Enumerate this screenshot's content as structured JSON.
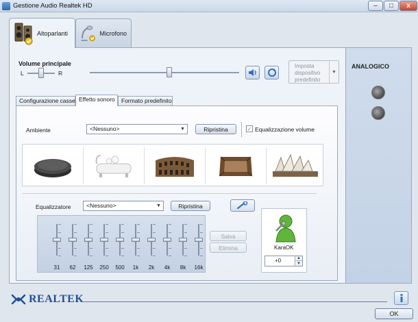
{
  "window": {
    "title": "Gestione Audio Realtek HD",
    "minimize": "–",
    "maximize": "□",
    "close": "x"
  },
  "device_tabs": [
    {
      "label": "Altoparlanti",
      "icon": "speakers-icon",
      "active": true
    },
    {
      "label": "Microfono",
      "icon": "microphone-icon",
      "active": false
    }
  ],
  "volume": {
    "title": "Volume principale",
    "left_label": "L",
    "right_label": "R",
    "balance_fraction": 0.5,
    "level_fraction": 0.52
  },
  "default_device": {
    "label": "Imposta dispositivo predefinito",
    "arrow": "▼"
  },
  "side_panel": {
    "label": "ANALOGICO",
    "jack_color": "#6e6e6e"
  },
  "sub_tabs": [
    {
      "label": "Configurazione casse",
      "active": false
    },
    {
      "label": "Effetto sonoro",
      "active": true
    },
    {
      "label": "Formato predefinito",
      "active": false
    }
  ],
  "environment": {
    "label": "Ambiente",
    "value": "<Nessuno>",
    "reset_label": "Ripristina",
    "loudness_label": "Equalizzazione volume",
    "loudness_checked": true,
    "presets": [
      "stone-icon",
      "bathtub-icon",
      "colosseum-icon",
      "arena-icon",
      "opera-house-icon"
    ]
  },
  "equalizer": {
    "label": "Equalizzatore",
    "value": "<Nessuno>",
    "reset_label": "Ripristina",
    "save_label": "Salva",
    "delete_label": "Elimina",
    "bands": [
      "31",
      "62",
      "125",
      "250",
      "500",
      "1k",
      "2k",
      "4k",
      "8k",
      "16k"
    ],
    "band_levels": [
      0.5,
      0.5,
      0.5,
      0.5,
      0.5,
      0.5,
      0.5,
      0.5,
      0.5,
      0.5
    ]
  },
  "karaoke": {
    "label": "KaraOK",
    "value": "+0",
    "up": "▲",
    "down": "▼"
  },
  "footer": {
    "brand": "REALTEK",
    "ok_label": "OK",
    "info": "i"
  },
  "colors": {
    "accent": "#1f4f94",
    "panel": "#eef3f9",
    "side_panel": "#c8d6e8"
  }
}
